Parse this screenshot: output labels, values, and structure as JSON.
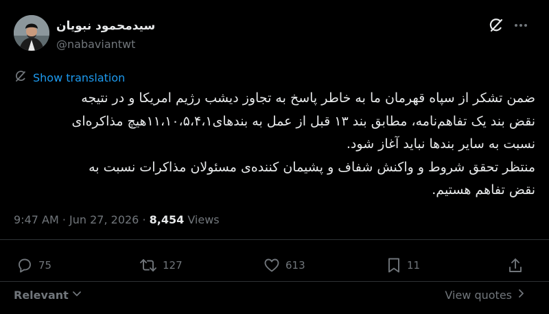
{
  "author": {
    "name": "سیدمحمود نبویان",
    "handle": "@nabaviantwt"
  },
  "translate_label": "Show translation",
  "tweet_lines": [
    "ضمن تشکر از سپاه قهرمان ما به خاطر پاسخ به تجاوز دیشب رژیم امریکا و در نتیجه",
    "نقض بند یک تفاهم‌نامه، مطابق بند ۱۳ قبل از عمل به بندهای۱۱،۱۰،۵،۴،۱هیچ مذاکره‌ای",
    "نسبت به سایر بندها نباید آغاز شود.",
    "منتظر تحقق شروط و واکنش شفاف و پشیمان کننده‌ی مسئولان مذاکرات نسبت به",
    "نقض تفاهم هستیم."
  ],
  "meta": {
    "time_date": "9:47 AM · Jun 27, 2026 · ",
    "views_count": "8,454",
    "views_label": " Views"
  },
  "actions": {
    "replies": "75",
    "retweets": "127",
    "likes": "613",
    "bookmarks": "11"
  },
  "footer": {
    "sort_label": "Relevant",
    "quotes_label": "View quotes"
  },
  "icons": [
    "grok-icon",
    "more-icon",
    "translate-icon",
    "reply-icon",
    "retweet-icon",
    "like-icon",
    "bookmark-icon",
    "share-icon",
    "chevron-down-icon",
    "chevron-right-icon"
  ]
}
